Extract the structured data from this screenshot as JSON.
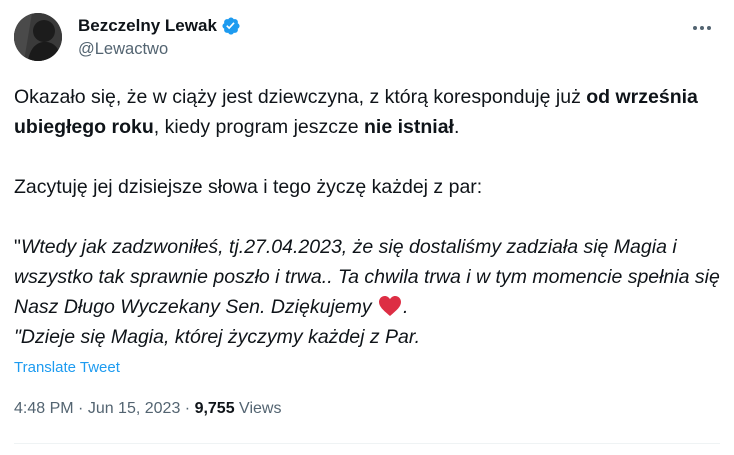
{
  "author": {
    "display_name": "Bezczelny Lewak",
    "handle": "@Lewactwo",
    "verified_icon": "verified-badge-icon",
    "avatar_icon": "profile-avatar"
  },
  "more_icon": "more-horizontal-icon",
  "tweet": {
    "p1_a": "Okazało się, że w ciąży jest dziewczyna, z którą koresponduję już ",
    "p1_b": "od września ubiegłego roku",
    "p1_c": ", kiedy program jeszcze ",
    "p1_d": "nie istniał",
    "p1_e": ".",
    "p2": "Zacytuję jej dzisiejsze słowa i tego życzę każdej z par:",
    "q_open": "\"",
    "q1": "Wtedy jak zadzwoniłeś, tj.27.04.2023, że się dostaliśmy zadziała się Magia i wszystko tak sprawnie poszło i trwa.. Ta chwila trwa i w tym momencie spełnia się  Nasz Długo Wyczekany Sen. Dziękujemy ",
    "heart_icon": "red-heart-icon",
    "q2": ".",
    "q3": "\"Dzieje się  Magia, której życzymy każdej z Par."
  },
  "translate_label": "Translate Tweet",
  "meta": {
    "time": "4:48 PM",
    "sep1": " · ",
    "date": "Jun 15, 2023",
    "sep2": " · ",
    "views_count": "9,755",
    "views_label": " Views"
  },
  "colors": {
    "accent": "#1d9bf0",
    "text": "#0f1419",
    "secondary": "#536471",
    "heart": "#e0245e"
  }
}
